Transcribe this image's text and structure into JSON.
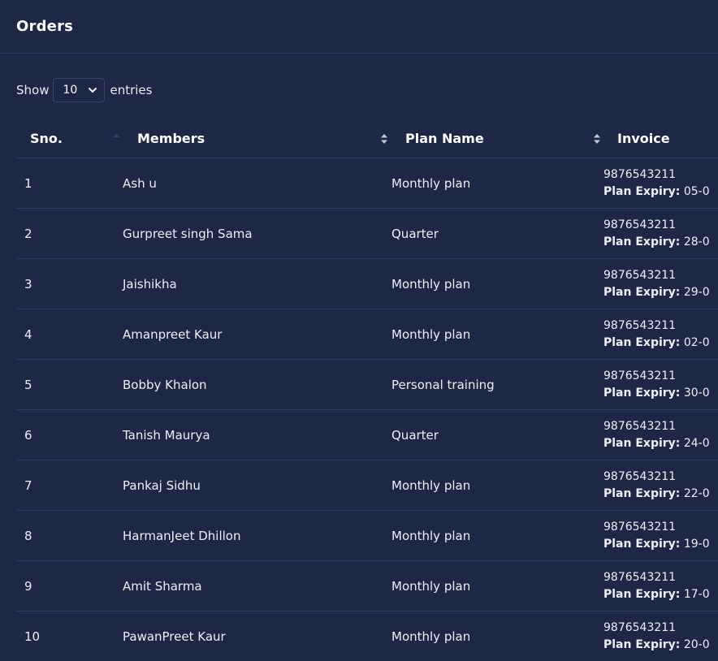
{
  "card": {
    "title": "Orders"
  },
  "length_menu": {
    "show_label": "Show",
    "selected": "10",
    "entries_label": "entries"
  },
  "table": {
    "columns": [
      "Sno.",
      "Members",
      "Plan Name",
      "Invoice"
    ],
    "expiry_label": "Plan Expiry:",
    "rows": [
      {
        "sno": "1",
        "member": "Ash u",
        "plan": "Monthly plan",
        "phone": "9876543211",
        "expiry": "05-0"
      },
      {
        "sno": "2",
        "member": "Gurpreet singh Sama",
        "plan": "Quarter",
        "phone": "9876543211",
        "expiry": "28-0"
      },
      {
        "sno": "3",
        "member": "Jaishikha",
        "plan": "Monthly plan",
        "phone": "9876543211",
        "expiry": "29-0"
      },
      {
        "sno": "4",
        "member": "Amanpreet Kaur",
        "plan": "Monthly plan",
        "phone": "9876543211",
        "expiry": "02-0"
      },
      {
        "sno": "5",
        "member": "Bobby Khalon",
        "plan": "Personal training",
        "phone": "9876543211",
        "expiry": "30-0"
      },
      {
        "sno": "6",
        "member": "Tanish Maurya",
        "plan": "Quarter",
        "phone": "9876543211",
        "expiry": "24-0"
      },
      {
        "sno": "7",
        "member": "Pankaj Sidhu",
        "plan": "Monthly plan",
        "phone": "9876543211",
        "expiry": "22-0"
      },
      {
        "sno": "8",
        "member": "HarmanJeet Dhillon",
        "plan": "Monthly plan",
        "phone": "9876543211",
        "expiry": "19-0"
      },
      {
        "sno": "9",
        "member": "Amit Sharma",
        "plan": "Monthly plan",
        "phone": "9876543211",
        "expiry": "17-0"
      },
      {
        "sno": "10",
        "member": "PawanPreet Kaur",
        "plan": "Monthly plan",
        "phone": "9876543211",
        "expiry": "20-0"
      }
    ]
  },
  "colors": {
    "background": "#1e2746",
    "divider": "#2f3a5e",
    "text": "#ffffff"
  },
  "icons": {
    "sort": "sort-updown-icon",
    "select": "chevron-down-icon"
  }
}
